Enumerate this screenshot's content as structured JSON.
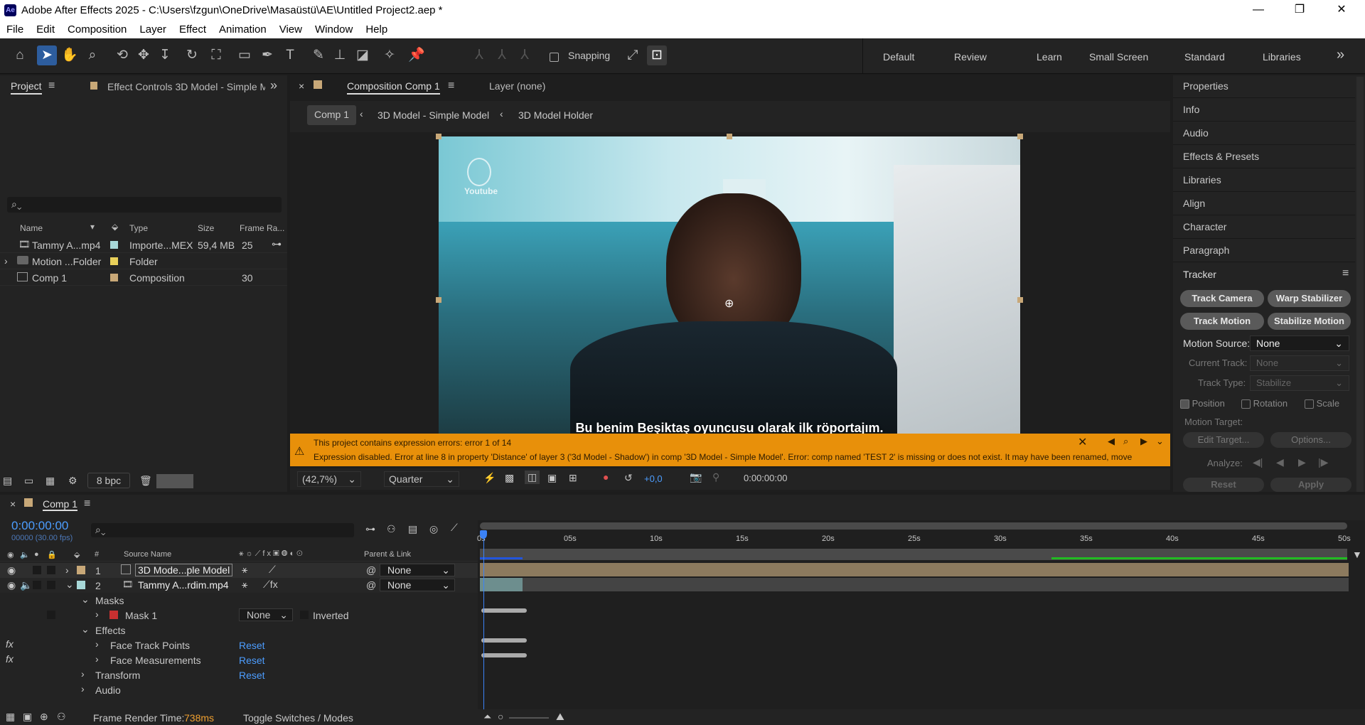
{
  "app": {
    "title": "Adobe After Effects 2025 - C:\\Users\\fzgun\\OneDrive\\Masaüstü\\AE\\Untitled Project2.aep *",
    "logo": "Ae"
  },
  "menu": [
    "File",
    "Edit",
    "Composition",
    "Layer",
    "Effect",
    "Animation",
    "View",
    "Window",
    "Help"
  ],
  "toolbar": {
    "snapping": "Snapping",
    "workspaces": [
      "Default",
      "Review",
      "Learn",
      "Small Screen",
      "Standard",
      "Libraries"
    ]
  },
  "project": {
    "tab": "Project",
    "effect_tab": "Effect Controls 3D Model - Simple M",
    "search_placeholder": "",
    "cols": {
      "name": "Name",
      "type": "Type",
      "size": "Size",
      "frame": "Frame Ra..."
    },
    "items": [
      {
        "name": "Tammy A...mp4",
        "type": "Importe...MEX",
        "size": "59,4 MB",
        "fr": "25",
        "color": "#a8d8d8",
        "icon": "video-file-icon"
      },
      {
        "name": "Motion ...Folder",
        "type": "Folder",
        "size": "",
        "fr": "",
        "color": "#e8d05a",
        "icon": "folder-icon"
      },
      {
        "name": "Comp 1",
        "type": "Composition",
        "size": "",
        "fr": "30",
        "color": "#c8a878",
        "icon": "composition-icon"
      }
    ],
    "bpc": "8 bpc"
  },
  "comp": {
    "tab": "Composition Comp 1",
    "layer_tab": "Layer (none)",
    "breadcrumbs": [
      "Comp 1",
      "3D Model - Simple Model",
      "3D Model Holder"
    ],
    "subtitle": "Bu benim Beşiktaş oyuncusu olarak ilk röportajım.",
    "watermark": "Youtube",
    "error_title": "This project contains expression errors: error 1 of 14",
    "error_text": "Expression disabled. Error at line 8 in property 'Distance' of layer 3 ('3d Model - Shadow') in comp '3D Model - Simple Model'.  Error: comp named 'TEST 2' is missing or does not exist. It may have been renamed, move",
    "zoom": "(42,7%)",
    "quality": "Quarter",
    "exposure": "+0,0",
    "timecode": "0:00:00:00"
  },
  "right": {
    "items": [
      "Properties",
      "Info",
      "Audio",
      "Effects & Presets",
      "Libraries",
      "Align",
      "Character",
      "Paragraph"
    ],
    "tracker": "Tracker",
    "buttons": [
      "Track Camera",
      "Warp Stabilizer",
      "Track Motion",
      "Stabilize Motion"
    ],
    "motion_source_label": "Motion Source:",
    "motion_source": "None",
    "current_track_label": "Current Track:",
    "current_track": "None",
    "track_type_label": "Track Type:",
    "track_type": "Stabilize",
    "position": "Position",
    "rotation": "Rotation",
    "scale": "Scale",
    "motion_target": "Motion Target:",
    "edit_target": "Edit Target...",
    "options": "Options...",
    "analyze": "Analyze:",
    "reset": "Reset",
    "apply": "Apply"
  },
  "timeline": {
    "tab": "Comp 1",
    "timecode": "0:00:00:00",
    "fps": "00000 (30.00 fps)",
    "col_source": "Source Name",
    "col_parent": "Parent & Link",
    "col_num": "#",
    "ticks": [
      "0s",
      "05s",
      "10s",
      "15s",
      "20s",
      "25s",
      "30s",
      "35s",
      "40s",
      "45s",
      "50s"
    ],
    "layers": [
      {
        "num": "1",
        "name": "3D Mode...ple Model",
        "parent": "None",
        "color": "#c8a878"
      },
      {
        "num": "2",
        "name": "Tammy A...rdim.mp4",
        "parent": "None",
        "color": "#a8d8d8"
      }
    ],
    "props": {
      "masks": "Masks",
      "mask1": "Mask 1",
      "mask_mode": "None",
      "inverted": "Inverted",
      "effects": "Effects",
      "fx1": "Face Track Points",
      "fx2": "Face Measurements",
      "transform": "Transform",
      "audio": "Audio",
      "reset": "Reset"
    },
    "render_label": "Frame Render Time:",
    "render_time": "738ms",
    "toggle": "Toggle Switches / Modes"
  }
}
